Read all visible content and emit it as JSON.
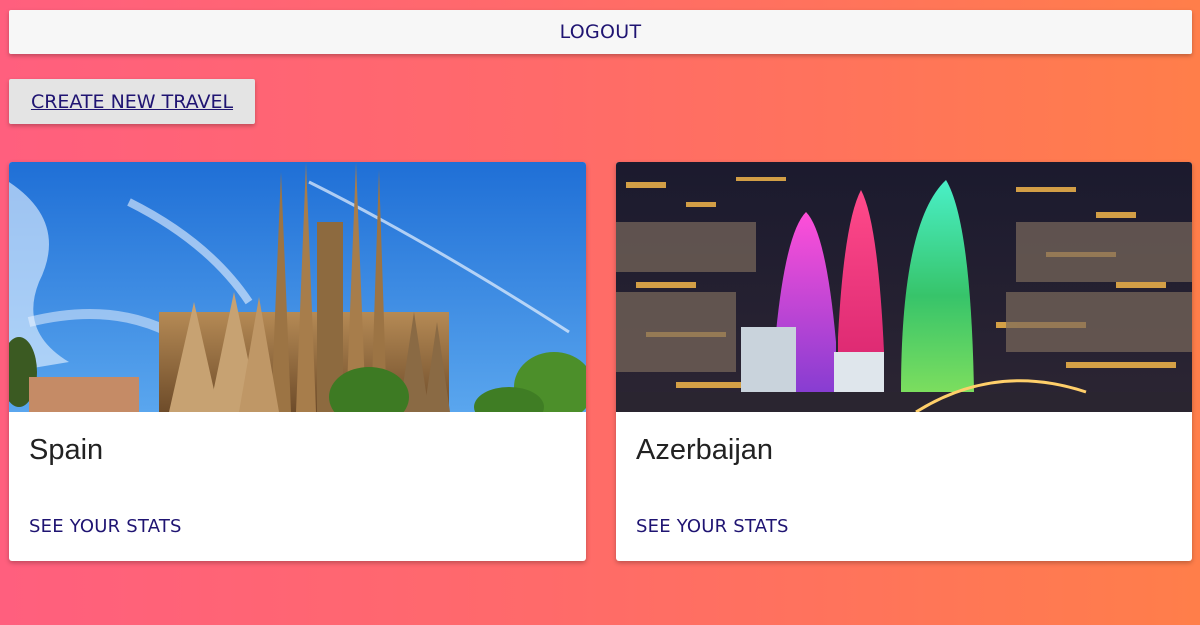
{
  "header": {
    "logout_label": "LOGOUT"
  },
  "actions": {
    "create_label": "CREATE NEW TRAVEL"
  },
  "travels": [
    {
      "title": "Spain",
      "action_label": "SEE YOUR STATS",
      "image": "sagrada-familia-photo"
    },
    {
      "title": "Azerbaijan",
      "action_label": "SEE YOUR STATS",
      "image": "baku-flame-towers-night-photo"
    }
  ],
  "colors": {
    "accent_text": "#1f1472",
    "gradient_start": "#ff5f7e",
    "gradient_end": "#ff7e4a"
  }
}
